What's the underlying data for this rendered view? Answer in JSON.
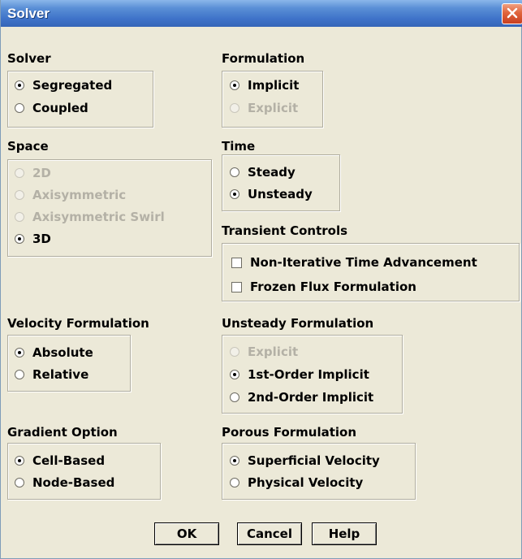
{
  "window": {
    "title": "Solver"
  },
  "groups": {
    "solver": {
      "title": "Solver",
      "options": [
        {
          "label": "Segregated",
          "selected": true,
          "enabled": true
        },
        {
          "label": "Coupled",
          "selected": false,
          "enabled": true
        }
      ]
    },
    "formulation": {
      "title": "Formulation",
      "options": [
        {
          "label": "Implicit",
          "selected": true,
          "enabled": true
        },
        {
          "label": "Explicit",
          "selected": false,
          "enabled": false
        }
      ]
    },
    "space": {
      "title": "Space",
      "options": [
        {
          "label": "2D",
          "selected": false,
          "enabled": false
        },
        {
          "label": "Axisymmetric",
          "selected": false,
          "enabled": false
        },
        {
          "label": "Axisymmetric Swirl",
          "selected": false,
          "enabled": false
        },
        {
          "label": "3D",
          "selected": true,
          "enabled": true
        }
      ]
    },
    "time": {
      "title": "Time",
      "options": [
        {
          "label": "Steady",
          "selected": false,
          "enabled": true
        },
        {
          "label": "Unsteady",
          "selected": true,
          "enabled": true
        }
      ]
    },
    "transient_controls": {
      "title": "Transient Controls",
      "options": [
        {
          "label": "Non-Iterative Time Advancement",
          "checked": false,
          "enabled": true
        },
        {
          "label": "Frozen Flux Formulation",
          "checked": false,
          "enabled": true
        }
      ]
    },
    "velocity_formulation": {
      "title": "Velocity Formulation",
      "options": [
        {
          "label": "Absolute",
          "selected": true,
          "enabled": true
        },
        {
          "label": "Relative",
          "selected": false,
          "enabled": true
        }
      ]
    },
    "unsteady_formulation": {
      "title": "Unsteady Formulation",
      "options": [
        {
          "label": "Explicit",
          "selected": false,
          "enabled": false
        },
        {
          "label": "1st-Order Implicit",
          "selected": true,
          "enabled": true
        },
        {
          "label": "2nd-Order Implicit",
          "selected": false,
          "enabled": true
        }
      ]
    },
    "gradient_option": {
      "title": "Gradient Option",
      "options": [
        {
          "label": "Cell-Based",
          "selected": true,
          "enabled": true
        },
        {
          "label": "Node-Based",
          "selected": false,
          "enabled": true
        }
      ]
    },
    "porous_formulation": {
      "title": "Porous Formulation",
      "options": [
        {
          "label": "Superficial Velocity",
          "selected": true,
          "enabled": true
        },
        {
          "label": "Physical Velocity",
          "selected": false,
          "enabled": true
        }
      ]
    }
  },
  "buttons": {
    "ok": "OK",
    "cancel": "Cancel",
    "help": "Help"
  },
  "icons": {
    "close": "close-icon",
    "radio": "radio-button",
    "checkbox": "checkbox"
  },
  "colors": {
    "dialog_bg": "#ece9d8",
    "title_blue": "#3f73c9",
    "close_red": "#e0643c",
    "disabled_text": "#b4b1a6"
  }
}
